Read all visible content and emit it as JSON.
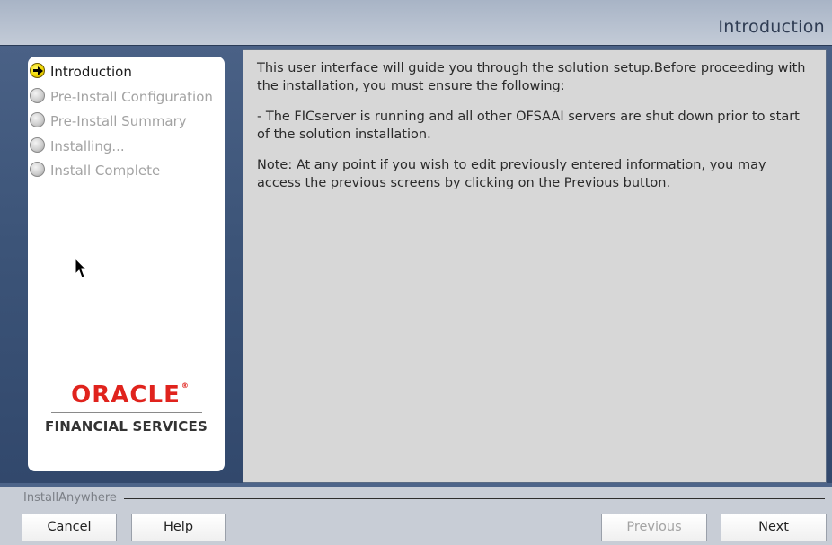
{
  "window": {
    "title": "Introduction"
  },
  "steps": [
    {
      "label": "Introduction",
      "state": "current"
    },
    {
      "label": "Pre-Install Configuration",
      "state": "pending"
    },
    {
      "label": "Pre-Install Summary",
      "state": "pending"
    },
    {
      "label": "Installing...",
      "state": "pending"
    },
    {
      "label": "Install Complete",
      "state": "pending"
    }
  ],
  "logo": {
    "brand": "ORACLE",
    "registered": "®",
    "division": "FINANCIAL SERVICES",
    "brand_color": "#e0231d"
  },
  "content": {
    "paragraphs": [
      "This user interface will guide you through the solution setup.Before proceeding with the installation, you must ensure the following:",
      "- The FICserver is running and all other OFSAAI servers are shut down prior to start of the solution installation.",
      "Note: At any point if you wish to edit previously entered information, you may access the previous screens by clicking on the Previous button."
    ]
  },
  "footer": {
    "brand": "InstallAnywhere",
    "buttons": {
      "cancel": {
        "label": "Cancel",
        "enabled": true
      },
      "help": {
        "label": "Help",
        "mnemonic": "H",
        "rest": "elp",
        "enabled": true
      },
      "previous": {
        "label": "Previous",
        "mnemonic": "P",
        "rest": "revious",
        "enabled": false
      },
      "next": {
        "label": "Next",
        "mnemonic": "N",
        "rest": "ext",
        "enabled": true
      }
    }
  },
  "colors": {
    "window_bg": "#3c5478",
    "titlebar_bg": "#c3cbd7",
    "content_bg": "#d7d7d7",
    "current_step_marker": "#f0d800"
  },
  "icons": {
    "current_step": "arrow-right-circle-icon",
    "pending_step": "gray-circle-icon",
    "pointer": "mouse-pointer-icon"
  }
}
